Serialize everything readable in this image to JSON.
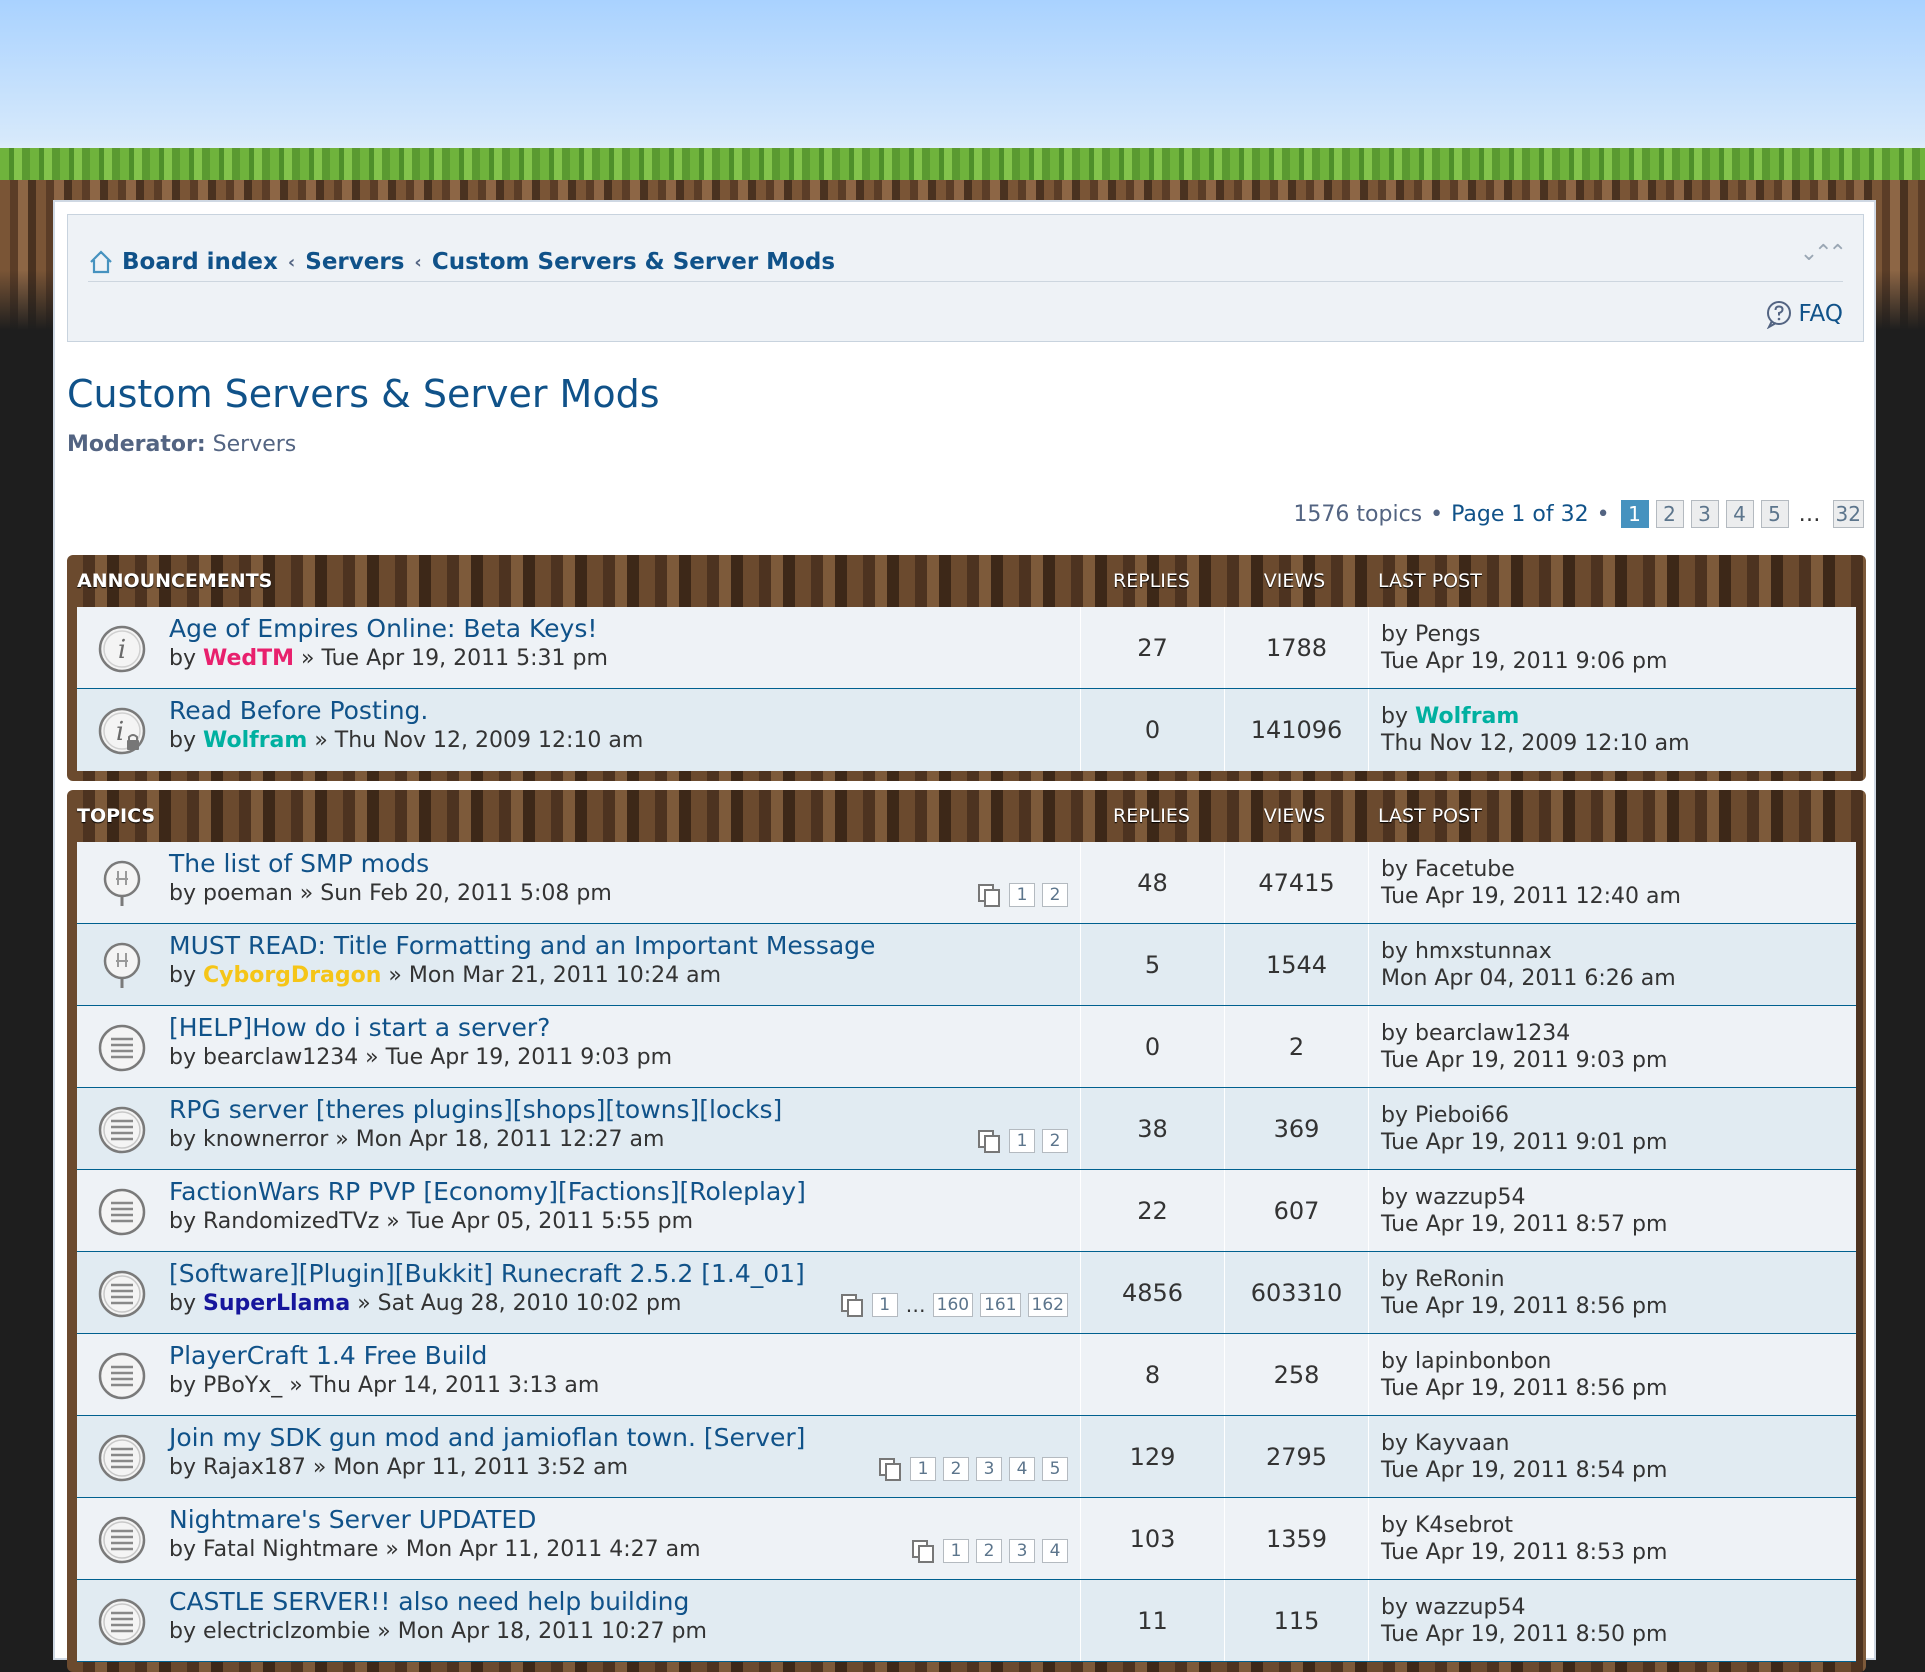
{
  "breadcrumb": {
    "items": [
      "Board index",
      "Servers",
      "Custom Servers & Server Mods"
    ]
  },
  "navbar": {
    "faq_label": "FAQ"
  },
  "forum": {
    "title": "Custom Servers & Server Mods",
    "moderator_label": "Moderator:",
    "moderator_value": "Servers"
  },
  "pagination": {
    "topics_count": "1576 topics",
    "page_text": "Page 1 of 32",
    "pages": [
      "1",
      "2",
      "3",
      "4",
      "5"
    ],
    "ellipsis": "…",
    "last_page": "32",
    "separator": "•"
  },
  "announcements": {
    "header": "ANNOUNCEMENTS",
    "col_replies": "REPLIES",
    "col_views": "VIEWS",
    "col_last": "LAST POST",
    "rows": [
      {
        "title": "Age of Empires Online: Beta Keys!",
        "by": "by",
        "author": "WedTM",
        "date": "» Tue Apr 19, 2011 5:31 pm",
        "replies": "27",
        "views": "1788",
        "last_by": "by Pengs",
        "last_date": "Tue Apr 19, 2011 9:06 pm"
      },
      {
        "title": "Read Before Posting.",
        "by": "by",
        "author": "Wolfram",
        "date": "» Thu Nov 12, 2009 12:10 am",
        "replies": "0",
        "views": "141096",
        "last_by": "by",
        "last_author": "Wolfram",
        "last_date": "Thu Nov 12, 2009 12:10 am"
      }
    ]
  },
  "topics": {
    "header": "TOPICS",
    "col_replies": "REPLIES",
    "col_views": "VIEWS",
    "col_last": "LAST POST",
    "rows": [
      {
        "title": "The list of SMP mods",
        "meta": "by poeman » Sun Feb 20, 2011 5:08 pm",
        "pages": [
          "1",
          "2"
        ],
        "replies": "48",
        "views": "47415",
        "last_by": "by Facetube",
        "last_date": "Tue Apr 19, 2011 12:40 am"
      },
      {
        "title": "MUST READ: Title Formatting and an Important Message",
        "by": "by",
        "author": "CyborgDragon",
        "date": "» Mon Mar 21, 2011 10:24 am",
        "replies": "5",
        "views": "1544",
        "last_by": "by hmxstunnax",
        "last_date": "Mon Apr 04, 2011 6:26 am"
      },
      {
        "title": "[HELP]How do i start a server?",
        "meta": "by bearclaw1234 » Tue Apr 19, 2011 9:03 pm",
        "replies": "0",
        "views": "2",
        "last_by": "by bearclaw1234",
        "last_date": "Tue Apr 19, 2011 9:03 pm"
      },
      {
        "title": "RPG server [theres plugins][shops][towns][locks]",
        "meta": "by knownerror » Mon Apr 18, 2011 12:27 am",
        "pages": [
          "1",
          "2"
        ],
        "replies": "38",
        "views": "369",
        "last_by": "by Pieboi66",
        "last_date": "Tue Apr 19, 2011 9:01 pm"
      },
      {
        "title": "FactionWars RP PVP [Economy][Factions][Roleplay]",
        "meta": "by RandomizedTVz » Tue Apr 05, 2011 5:55 pm",
        "replies": "22",
        "views": "607",
        "last_by": "by wazzup54",
        "last_date": "Tue Apr 19, 2011 8:57 pm"
      },
      {
        "title": "[Software][Plugin][Bukkit] Runecraft 2.5.2 [1.4_01]",
        "by": "by",
        "author": "SuperLlama",
        "date": "» Sat Aug 28, 2010 10:02 pm",
        "pages": [
          "1"
        ],
        "ellipsis": "…",
        "pages_end": [
          "160",
          "161",
          "162"
        ],
        "replies": "4856",
        "views": "603310",
        "last_by": "by ReRonin",
        "last_date": "Tue Apr 19, 2011 8:56 pm"
      },
      {
        "title": "PlayerCraft 1.4 Free Build",
        "meta": "by PBoYx_ » Thu Apr 14, 2011 3:13 am",
        "replies": "8",
        "views": "258",
        "last_by": "by lapinbonbon",
        "last_date": "Tue Apr 19, 2011 8:56 pm"
      },
      {
        "title": "Join my SDK gun mod and jamioflan town. [Server]",
        "meta": "by Rajax187 » Mon Apr 11, 2011 3:52 am",
        "pages": [
          "1",
          "2",
          "3",
          "4",
          "5"
        ],
        "replies": "129",
        "views": "2795",
        "last_by": "by Kayvaan",
        "last_date": "Tue Apr 19, 2011 8:54 pm"
      },
      {
        "title": "Nightmare's Server UPDATED",
        "meta": "by Fatal Nightmare » Mon Apr 11, 2011 4:27 am",
        "pages": [
          "1",
          "2",
          "3",
          "4"
        ],
        "replies": "103",
        "views": "1359",
        "last_by": "by K4sebrot",
        "last_date": "Tue Apr 19, 2011 8:53 pm"
      },
      {
        "title": "CASTLE SERVER!! also need help building",
        "meta": "by electriclzombie » Mon Apr 18, 2011 10:27 pm",
        "replies": "11",
        "views": "115",
        "last_by": "by wazzup54",
        "last_date": "Tue Apr 19, 2011 8:50 pm"
      }
    ]
  }
}
